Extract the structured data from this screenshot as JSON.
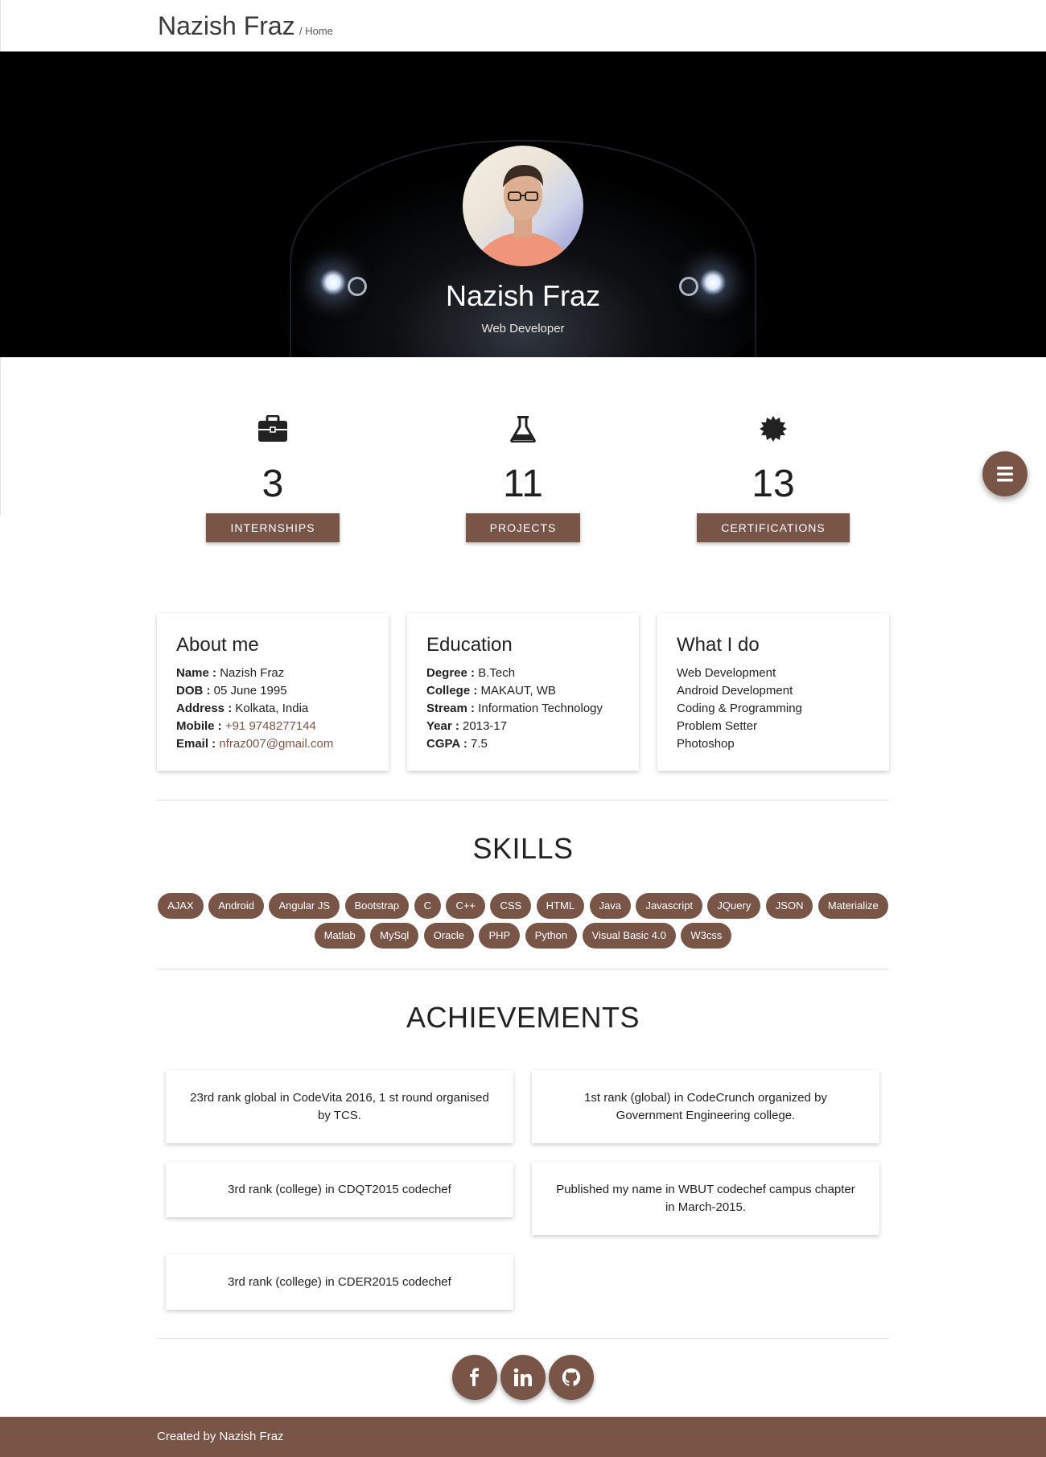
{
  "header": {
    "brand": "Nazish Fraz",
    "breadcrumb": "/ Home"
  },
  "hero": {
    "name": "Nazish Fraz",
    "role": "Web Developer"
  },
  "stats": [
    {
      "icon": "briefcase-icon",
      "value": "3",
      "label": "INTERNSHIPS"
    },
    {
      "icon": "flask-icon",
      "value": "11",
      "label": "PROJECTS"
    },
    {
      "icon": "certificate-icon",
      "value": "13",
      "label": "CERTIFICATIONS"
    }
  ],
  "fab": {
    "icon": "menu-icon"
  },
  "about": {
    "title": "About me",
    "name_label": "Name :",
    "name": "Nazish Fraz",
    "dob_label": "DOB :",
    "dob": "05 June 1995",
    "address_label": "Address :",
    "address": "Kolkata, India",
    "mobile_label": "Mobile :",
    "mobile": "+91 9748277144",
    "email_label": "Email :",
    "email": "nfraz007@gmail.com"
  },
  "education": {
    "title": "Education",
    "degree_label": "Degree :",
    "degree": "B.Tech",
    "college_label": "College :",
    "college": "MAKAUT, WB",
    "stream_label": "Stream :",
    "stream": "Information Technology",
    "year_label": "Year :",
    "year": "2013-17",
    "cgpa_label": "CGPA :",
    "cgpa": "7.5"
  },
  "what_i_do": {
    "title": "What I do",
    "items": [
      "Web Development",
      "Android Development",
      "Coding & Programming",
      "Problem Setter",
      "Photoshop"
    ]
  },
  "skills": {
    "title": "SKILLS",
    "items": [
      "AJAX",
      "Android",
      "Angular JS",
      "Bootstrap",
      "C",
      "C++",
      "CSS",
      "HTML",
      "Java",
      "Javascript",
      "JQuery",
      "JSON",
      "Materialize",
      "Matlab",
      "MySql",
      "Oracle",
      "PHP",
      "Python",
      "Visual Basic 4.0",
      "W3css"
    ]
  },
  "achievements": {
    "title": "ACHIEVEMENTS",
    "items": [
      "23rd rank global in CodeVita 2016, 1 st round organised by TCS.",
      "1st rank (global) in CodeCrunch organized by Government Engineering college.",
      "3rd rank (college) in CDQT2015 codechef",
      "Published my name in WBUT codechef campus chapter in March-2015.",
      "3rd rank (college) in CDER2015 codechef"
    ]
  },
  "social": [
    {
      "icon": "facebook-icon"
    },
    {
      "icon": "linkedin-icon"
    },
    {
      "icon": "github-icon"
    }
  ],
  "footer": {
    "text": "Created by Nazish Fraz"
  },
  "colors": {
    "accent": "#795548",
    "hero_bg": "#000000"
  }
}
